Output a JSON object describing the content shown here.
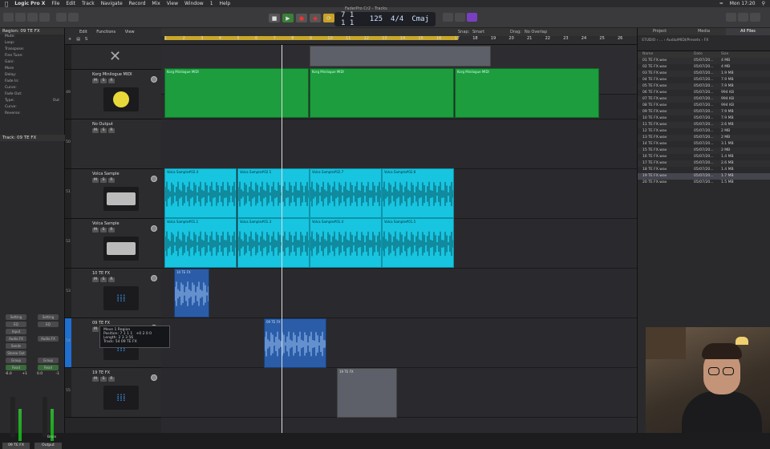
{
  "menubar": {
    "app": "Logic Pro X",
    "items": [
      "File",
      "Edit",
      "Track",
      "Navigate",
      "Record",
      "Mix",
      "View",
      "Window",
      "1",
      "Help"
    ],
    "clock": "Mon 17:20"
  },
  "window_title": "FaderPro Cr2 - Tracks",
  "lcd": {
    "bar": "7",
    "beat": "1",
    "div": "1",
    "tick": "1",
    "tempo": "125",
    "sig": "4/4",
    "key": "Cmaj"
  },
  "inspector": {
    "region_title": "Region: 09 TE FX",
    "rows": [
      {
        "label": "Mute:",
        "value": ""
      },
      {
        "label": "Loop:",
        "value": ""
      },
      {
        "label": "Transpose:",
        "value": ""
      },
      {
        "label": "Fine Tune:",
        "value": ""
      },
      {
        "label": "Gain:",
        "value": ""
      },
      {
        "label": "More",
        "value": ""
      },
      {
        "label": "Delay:",
        "value": ""
      },
      {
        "label": "Fade In:",
        "value": ""
      },
      {
        "label": "Curve:",
        "value": ""
      },
      {
        "label": "Fade Out:",
        "value": ""
      },
      {
        "label": "Type:",
        "value": "Out"
      },
      {
        "label": "Curve:",
        "value": ""
      },
      {
        "label": "Reverse:",
        "value": ""
      }
    ],
    "track_title": "Track: 09 TE FX",
    "strip1": {
      "setting": "Setting",
      "eq": "EQ",
      "input": "Input",
      "audio_fx": "Audio FX",
      "sends": "Sends",
      "output": "Stereo Out",
      "group": "Group",
      "auto": "Read",
      "vol": "-6.0",
      "pan": "+1",
      "name": "09 TE FX"
    },
    "strip2": {
      "setting": "Setting",
      "eq": "EQ",
      "audio_fx": "Audio FX",
      "group": "Group",
      "auto": "Read",
      "vol": "0.0",
      "pan": "-1",
      "bounce": "Bnce",
      "name": "Output"
    }
  },
  "track_tools": {
    "edit": "Edit",
    "functions": "Functions",
    "view": "View"
  },
  "tracks": [
    {
      "num": "",
      "name": "",
      "type": "x"
    },
    {
      "num": "49",
      "name": "Korg Minilogue MIDI",
      "type": "synth"
    },
    {
      "num": "50",
      "name": "No Output",
      "type": "empty"
    },
    {
      "num": "51",
      "name": "Volca Sample",
      "type": "volca"
    },
    {
      "num": "52",
      "name": "Volca Sample",
      "type": "volca"
    },
    {
      "num": "53",
      "name": "10 TE FX",
      "type": "wave"
    },
    {
      "num": "54",
      "name": "09 TE FX",
      "type": "wave"
    },
    {
      "num": "55",
      "name": "19 TE FX",
      "type": "wave"
    }
  ],
  "ruler": {
    "snap_label": "Snap:",
    "snap_value": "Smart",
    "drag_label": "Drag:",
    "drag_value": "No Overlap",
    "bars": [
      "1",
      "2",
      "3",
      "4",
      "5",
      "6",
      "7",
      "8",
      "9",
      "10",
      "11",
      "12",
      "13",
      "14",
      "15",
      "16",
      "17",
      "18",
      "19",
      "20",
      "21",
      "22",
      "23",
      "24",
      "25",
      "26"
    ]
  },
  "regions": {
    "korg": [
      "Korg Minilogue MIDI",
      "Korg Minilogue MIDI",
      "Korg Minilogue MIDI"
    ],
    "volca1": [
      "Volca Sample#02.4",
      "Volca Sample#02.5",
      "Volca Sample#02.7",
      "Volca Sample#02.8"
    ],
    "volca2": [
      "Volca Sample#01.1",
      "Volca Sample#01.3",
      "Volca Sample#01.4",
      "Volca Sample#01.5"
    ],
    "fx10": "10 TE FX",
    "fx09": "09 TE FX",
    "fx19": "19 TE FX"
  },
  "tooltip": {
    "title": "Move 1 Region",
    "position_label": "Position:",
    "position": "7 1 1 1",
    "delta": "+0 2 0 0",
    "length_label": "Length:",
    "length": "2 3 3 56",
    "track_label": "Track:",
    "track": "54 09 TE FX"
  },
  "browser": {
    "tabs": [
      "Project",
      "Media",
      "All Files"
    ],
    "path": "STUDIO  ›  ...  ›  Audio/MIDI/Presets  ›  FX",
    "columns": [
      "Name",
      "Date",
      "Size"
    ],
    "files": [
      {
        "name": "01 TE FX.wav",
        "date": "05/07/20...",
        "size": "4 MB"
      },
      {
        "name": "02 TE FX.wav",
        "date": "05/07/20...",
        "size": "4 MB"
      },
      {
        "name": "03 TE FX.wav",
        "date": "05/07/20...",
        "size": "1.9 MB"
      },
      {
        "name": "04 TE FX.wav",
        "date": "05/07/20...",
        "size": "7.9 MB"
      },
      {
        "name": "05 TE FX.wav",
        "date": "05/07/20...",
        "size": "7.9 MB"
      },
      {
        "name": "06 TE FX.wav",
        "date": "05/07/20...",
        "size": "994 KB"
      },
      {
        "name": "07 TE FX.wav",
        "date": "05/07/20...",
        "size": "994 KB"
      },
      {
        "name": "08 TE FX.wav",
        "date": "05/07/20...",
        "size": "994 KB"
      },
      {
        "name": "09 TE FX.wav",
        "date": "05/07/20...",
        "size": "7.9 MB"
      },
      {
        "name": "10 TE FX.wav",
        "date": "05/07/20...",
        "size": "7.9 MB"
      },
      {
        "name": "11 TE FX.wav",
        "date": "05/07/20...",
        "size": "2.6 MB"
      },
      {
        "name": "12 TE FX.wav",
        "date": "05/07/20...",
        "size": "2 MB"
      },
      {
        "name": "13 TE FX.wav",
        "date": "05/07/20...",
        "size": "2 MB"
      },
      {
        "name": "14 TE FX.wav",
        "date": "05/07/20...",
        "size": "3.1 MB"
      },
      {
        "name": "15 TE FX.wav",
        "date": "05/07/20...",
        "size": "2 MB"
      },
      {
        "name": "16 TE FX.wav",
        "date": "05/07/20...",
        "size": "1.4 MB"
      },
      {
        "name": "17 TE FX.wav",
        "date": "05/07/20...",
        "size": "2.6 MB"
      },
      {
        "name": "18 TE FX.wav",
        "date": "05/07/20...",
        "size": "1.4 MB"
      },
      {
        "name": "19 TE FX.wav",
        "date": "05/07/20...",
        "size": "1.7 MB"
      },
      {
        "name": "20 TE FX.wav",
        "date": "05/07/20...",
        "size": "1.5 MB"
      }
    ]
  },
  "colors": {
    "midi": "#1d9d3d",
    "audio": "#17c5e0",
    "fx": "#2a5ca8",
    "cycle": "#c8a72a"
  }
}
